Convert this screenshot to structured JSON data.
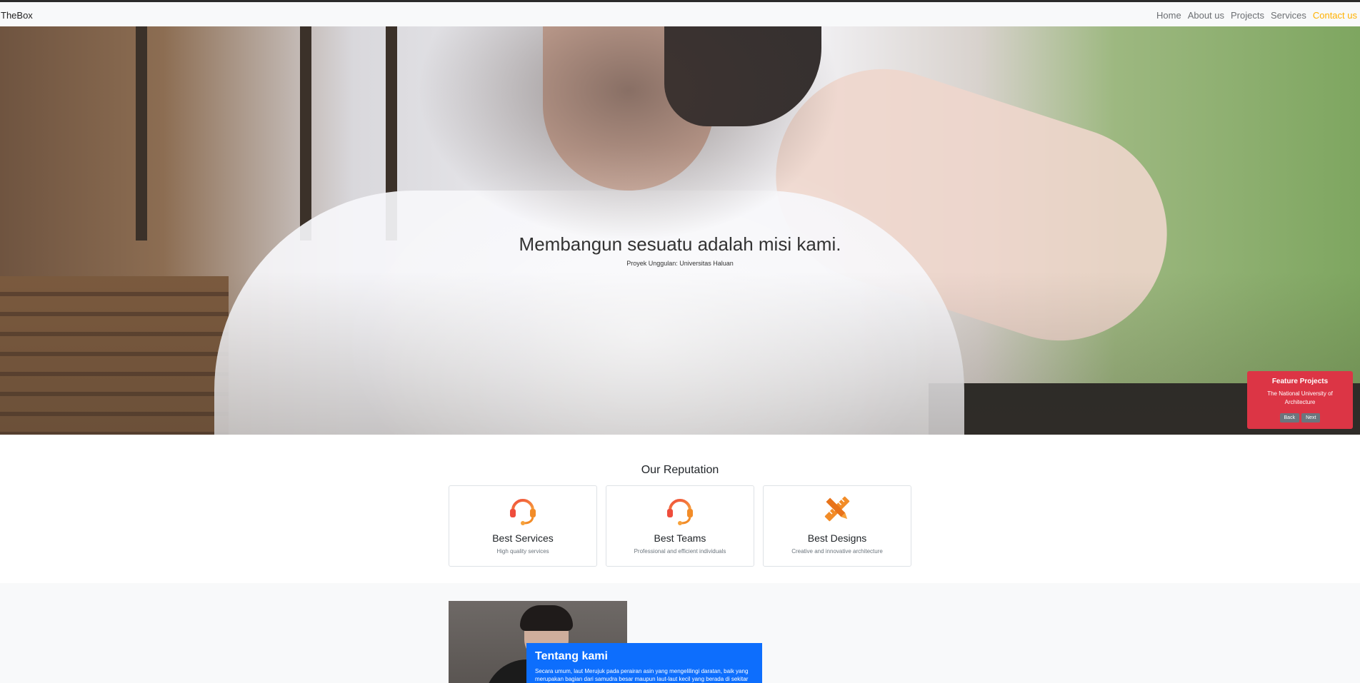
{
  "navbar": {
    "brand": "TheBox",
    "links": [
      "Home",
      "About us",
      "Projects",
      "Services",
      "Contact us"
    ]
  },
  "hero": {
    "title": "Membangun sesuatu adalah misi kami.",
    "subtitle": "Proyek Unggulan: Universitas Haluan"
  },
  "feature": {
    "title": "Feature Projects",
    "subtitle": "The National University of Architecture",
    "back_label": "Back",
    "next_label": "Next"
  },
  "reputation": {
    "heading": "Our Reputation",
    "cards": [
      {
        "title": "Best Services",
        "subtitle": "High quality services",
        "icon": "headset-icon"
      },
      {
        "title": "Best Teams",
        "subtitle": "Professional and efficient individuals",
        "icon": "headset-icon"
      },
      {
        "title": "Best Designs",
        "subtitle": "Creative and innovative architecture",
        "icon": "ruler-pencil-icon"
      }
    ]
  },
  "about": {
    "title": "Tentang kami",
    "text": "Secara umum, laut Merujuk pada perairan asin yang mengelilingi daratan, baik yang merupakan bagian dari samudra besar maupun laut-laut kecil yang berada di sekitar"
  },
  "colors": {
    "accent": "#ffb100",
    "feature_bg": "#dc3545",
    "about_bg": "#0d6efd",
    "icon_orange": "#f28c28"
  }
}
